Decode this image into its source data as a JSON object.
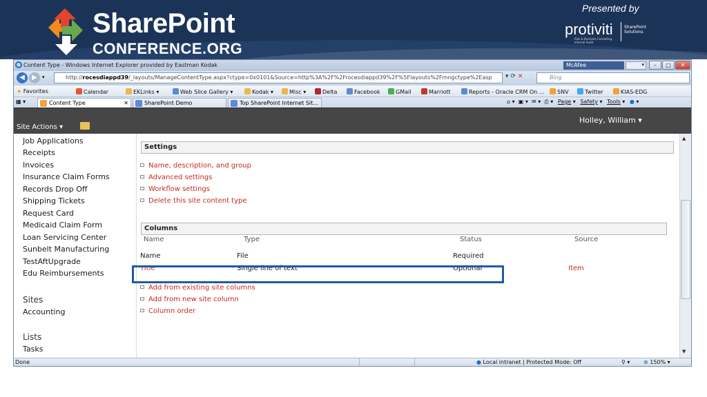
{
  "banner": {
    "brand_title": "SharePoint",
    "brand_subtitle": "CONFERENCE.ORG",
    "presented_by": "Presented by",
    "sponsor": "protiviti",
    "sponsor_tagline": "Risk & Business Consulting. Internal Audit.",
    "sponsor_division": "SharePoint Solutions"
  },
  "browser": {
    "window_title": "Content Type - Windows Internet Explorer provided by Eastman Kodak",
    "toolbar_widget": "McAfee",
    "address": {
      "prefix": "http://",
      "host": "rocesdiappd39",
      "path": "/_layouts/ManageContentType.aspx?ctype=0x0101&Source=http%3A%2F%2Frocesdiappd39%2F%5Flayouts%2Fmngctype%2Easp"
    },
    "search_placeholder": "Bing",
    "favorites": [
      "Favorites",
      "Calendar",
      "EKLinks",
      "Web Slice Gallery",
      "Kodak",
      "Misc",
      "Delta",
      "Facebook",
      "GMail",
      "Marriott",
      "Reports - Oracle CRM On ...",
      "SNV",
      "Twitter",
      "KIAS-EDG"
    ],
    "tabs": [
      "Content Type",
      "SharePoint Demo",
      "Top SharePoint Internet Sit..."
    ],
    "tab_tools": [
      "Page",
      "Safety",
      "Tools"
    ],
    "status": {
      "left": "Done",
      "zone": "Local intranet | Protected Mode: Off",
      "zoom": "150%"
    }
  },
  "sharepoint": {
    "site_actions": "Site Actions",
    "user": "Holley, William",
    "left_nav": {
      "libraries": [
        "Job Applications",
        "Receipts",
        "Invoices",
        "Insurance Claim Forms",
        "Records Drop Off",
        "Shipping Tickets",
        "Request Card",
        "Medicaid Claim Form",
        "Loan Servicing Center",
        "Sunbelt Manufacturing",
        "TestAftUpgrade",
        "Edu Reimbursements"
      ],
      "sites_heading": "Sites",
      "sites": [
        "Accounting"
      ],
      "lists_heading": "Lists",
      "lists": [
        "Tasks"
      ]
    },
    "settings": {
      "heading": "Settings",
      "links": [
        "Name, description, and group",
        "Advanced settings",
        "Workflow settings",
        "Delete this site content type"
      ]
    },
    "columns": {
      "heading": "Columns",
      "headers": [
        "Name",
        "Type",
        "Status",
        "Source"
      ],
      "rows": [
        {
          "name": "Name",
          "type": "File",
          "status": "Required",
          "source": ""
        },
        {
          "name": "Title",
          "type": "Single line of text",
          "status": "Optional",
          "source": "Item"
        }
      ],
      "links": [
        "Add from existing site columns",
        "Add from new site column",
        "Column order"
      ]
    }
  }
}
